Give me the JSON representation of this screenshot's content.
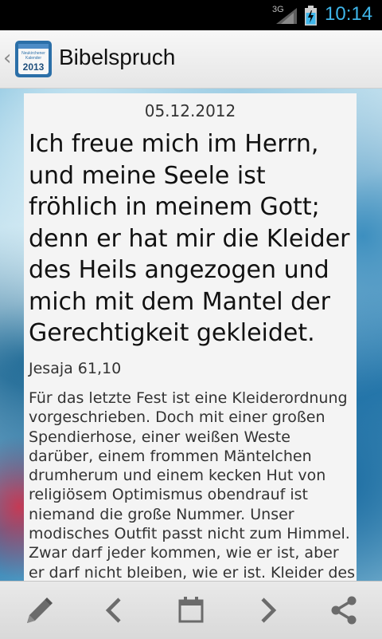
{
  "status_bar": {
    "network": "3G",
    "time": "10:14",
    "time_color": "#3fb6ea"
  },
  "action_bar": {
    "title": "Bibelspruch",
    "app_icon": {
      "line1": "Neukirchener",
      "line2": "Kalender",
      "year": "2013"
    }
  },
  "content": {
    "date": "05.12.2012",
    "verse": "Ich freue mich im Herrn, und meine Seele ist fröhlich in meinem Gott; denn er hat mir die Kleider des Heils angezogen und mich mit dem Mantel der Gerechtigkeit gekleidet.",
    "reference": "Jesaja 61,10",
    "text": "Für das letzte Fest ist eine Kleiderordnung vorgeschrieben. Doch mit einer großen Spendierhose, einer weißen Weste darüber, einem frommen Mäntelchen drumherum und einem kecken Hut von religiösem Optimismus obendrauf ist niemand die große Nummer. Unser modisches Outfit passt nicht zum Himmel. Zwar darf jeder kommen, wie er ist, aber er darf nicht bleiben, wie er ist. Kleider des Heils sollen"
  },
  "bottom_bar": {
    "icons": [
      "pencil-icon",
      "chevron-left-icon",
      "calendar-icon",
      "chevron-right-icon",
      "share-icon"
    ],
    "icon_color": "#6b6b6b"
  }
}
